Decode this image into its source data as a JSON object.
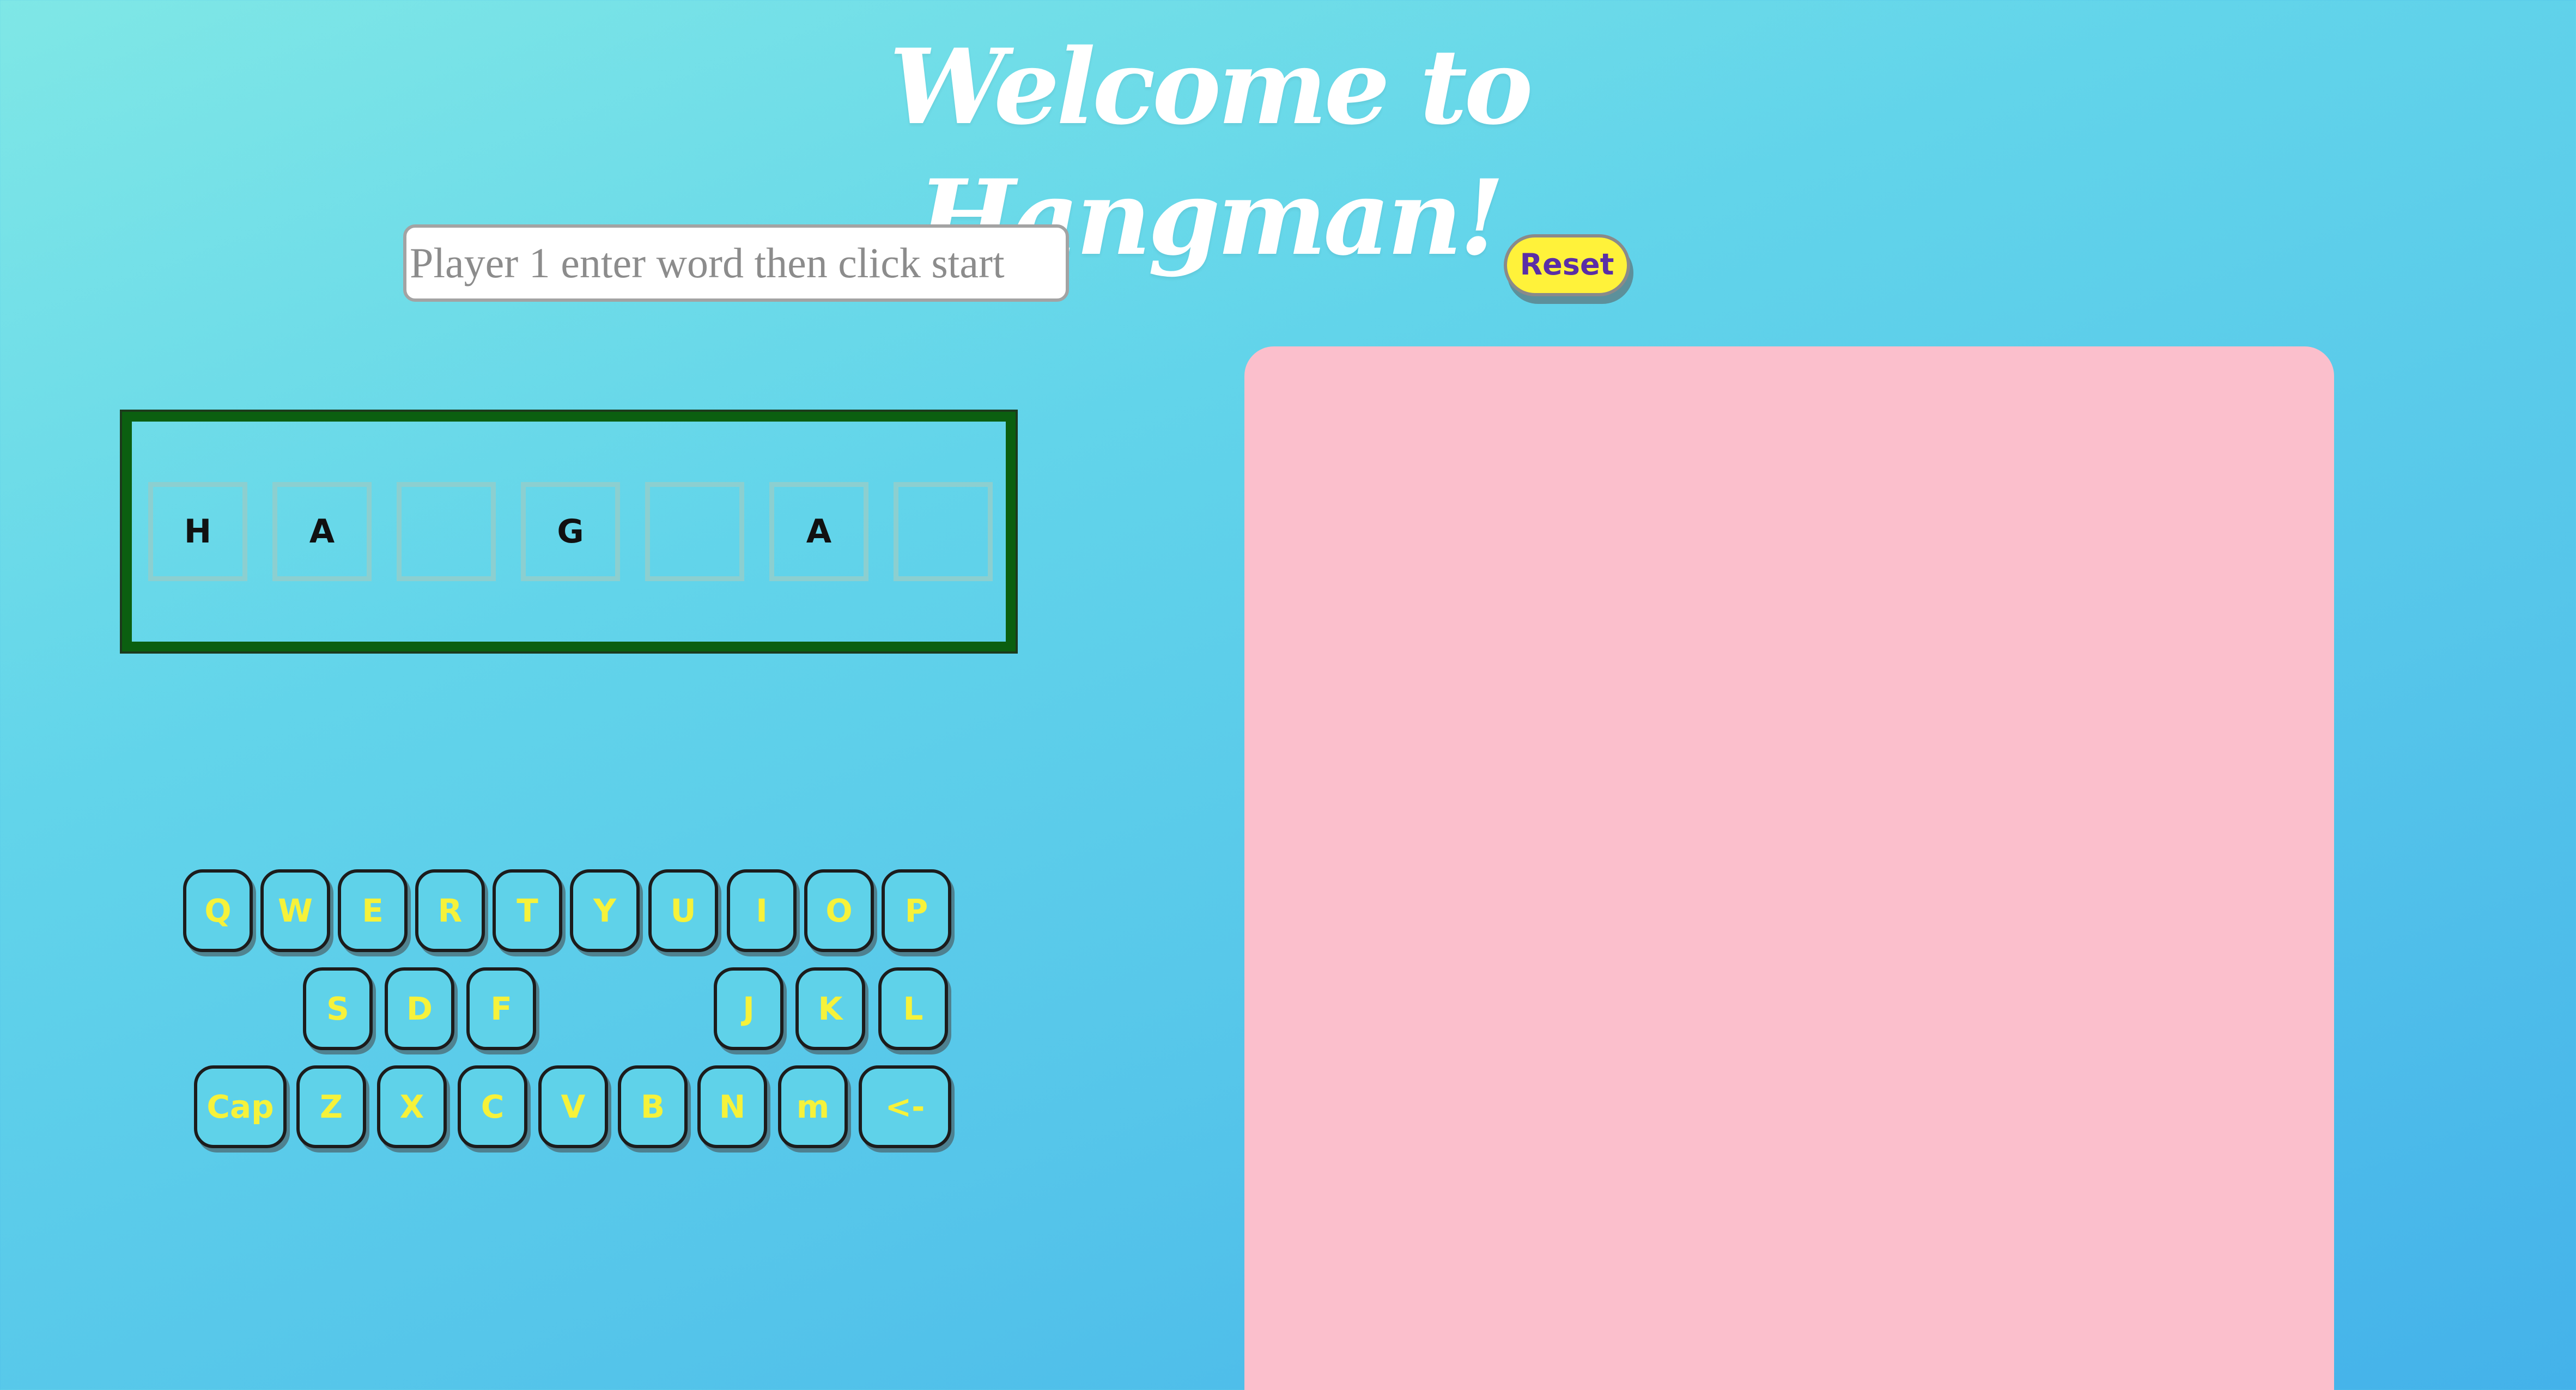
{
  "header": {
    "title": "Welcome to Hangman!"
  },
  "controls": {
    "word_input_placeholder": "Player 1 enter word then click start",
    "word_input_value": "",
    "reset_label": "Reset"
  },
  "word": {
    "slots": [
      "H",
      "A",
      "",
      "G",
      "",
      "A",
      ""
    ]
  },
  "keyboard": {
    "rows": [
      [
        "Q",
        "W",
        "E",
        "R",
        "T",
        "Y",
        "U",
        "I",
        "O",
        "P"
      ],
      [
        "S",
        "D",
        "F",
        "J",
        "K",
        "L"
      ],
      [
        "Cap",
        "Z",
        "X",
        "C",
        "V",
        "B",
        "N",
        "m",
        "<-"
      ]
    ]
  },
  "colors": {
    "background_start": "#7fe7e6",
    "background_end": "#44b2ea",
    "key_text": "#f6f23a",
    "reset_button": "#fff23a",
    "reset_text": "#5a2ea6",
    "word_box_border": "#0b5f10",
    "drawing_panel": "#fbbfcc"
  }
}
